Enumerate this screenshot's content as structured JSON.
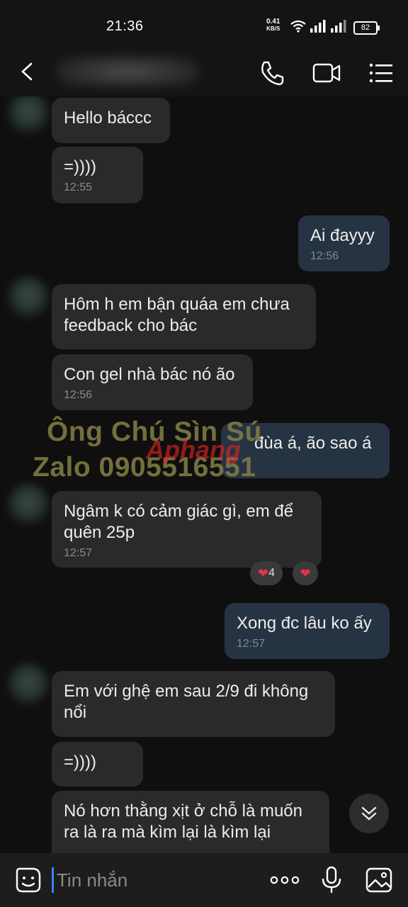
{
  "status": {
    "time": "21:36",
    "net_speed": "0.41",
    "net_unit": "KB/S",
    "battery": "82"
  },
  "messages": [
    {
      "dir": "in",
      "text": "Hello báccc"
    },
    {
      "dir": "in",
      "text": "=))))",
      "time": "12:55"
    },
    {
      "dir": "out",
      "text": "Ai đayyy",
      "time": "12:56"
    },
    {
      "dir": "in",
      "text": "Hôm h em bận quáa em chưa feedback cho bác"
    },
    {
      "dir": "in",
      "text": "Con gel nhà bác nó ão",
      "time": "12:56"
    },
    {
      "dir": "out",
      "text": "đùa á, ão sao á"
    },
    {
      "dir": "in",
      "text": "Ngâm k có cảm giác gì, em để quên 25p",
      "time": "12:57"
    },
    {
      "dir": "out",
      "text": "Xong đc lâu ko ấy",
      "time": "12:57"
    },
    {
      "dir": "in",
      "text": "Em với ghệ em sau 2/9 đi không nổi"
    },
    {
      "dir": "in",
      "text": "=))))"
    },
    {
      "dir": "in",
      "text": "Nó hơn thằng xịt ở chỗ là muốn ra là ra mà kìm lại là kìm lại"
    }
  ],
  "reaction": {
    "count": "4"
  },
  "watermark": {
    "line1": "Ông Chú Sìn Sú",
    "line2": "Zalo 0905516551",
    "logo": "Aphang"
  },
  "input": {
    "placeholder": "Tin nhắn"
  },
  "icons": [
    "back-icon",
    "phone-icon",
    "video-call-icon",
    "menu-icon",
    "sticker-icon",
    "more-icon",
    "microphone-icon",
    "image-icon",
    "chevron-double-down-icon"
  ]
}
